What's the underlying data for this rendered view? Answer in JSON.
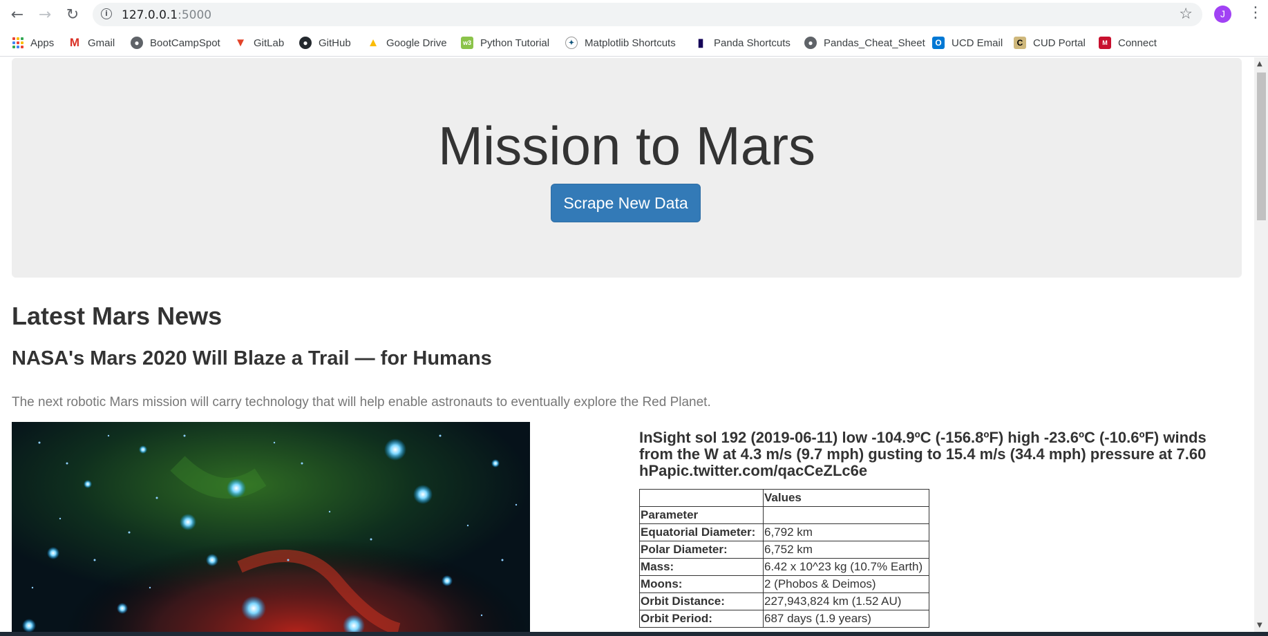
{
  "browser": {
    "url_host": "127.0.0.1",
    "url_port": ":5000",
    "profile_initial": "J",
    "bookmarks": [
      {
        "label": "Apps",
        "icon": "apps-grid-icon"
      },
      {
        "label": "Gmail",
        "icon": "gmail-icon"
      },
      {
        "label": "BootCampSpot",
        "icon": "globe-icon"
      },
      {
        "label": "GitLab",
        "icon": "gitlab-icon"
      },
      {
        "label": "GitHub",
        "icon": "github-icon"
      },
      {
        "label": "Google Drive",
        "icon": "google-drive-icon"
      },
      {
        "label": "Python Tutorial",
        "icon": "python-tutorial-icon"
      },
      {
        "label": "Matplotlib Shortcuts",
        "icon": "matplotlib-icon"
      },
      {
        "label": "Panda Shortcuts",
        "icon": "panda-icon"
      },
      {
        "label": "Pandas_Cheat_Sheet",
        "icon": "globe-icon"
      },
      {
        "label": "UCD Email",
        "icon": "outlook-icon"
      },
      {
        "label": "CUD Portal",
        "icon": "cu-icon"
      },
      {
        "label": "Connect",
        "icon": "connect-icon"
      }
    ]
  },
  "jumbotron": {
    "title": "Mission to Mars",
    "button_label": "Scrape New Data"
  },
  "news": {
    "section_title": "Latest Mars News",
    "headline": "NASA's Mars 2020 Will Blaze a Trail — for Humans",
    "teaser": "The next robotic Mars mission will carry technology that will help enable astronauts to eventually explore the Red Planet."
  },
  "weather": {
    "text": "InSight sol 192 (2019-06-11) low -104.9ºC (-156.8ºF) high -23.6ºC (-10.6ºF) winds from the W at 4.3 m/s (9.7 mph) gusting to 15.4 m/s (34.4 mph) pressure at 7.60 hPapic.twitter.com/qacCeZLc6e"
  },
  "facts": {
    "header_values": "Values",
    "header_parameter": "Parameter",
    "rows": [
      {
        "label": "Equatorial Diameter:",
        "value": "6,792 km"
      },
      {
        "label": "Polar Diameter:",
        "value": "6,752 km"
      },
      {
        "label": "Mass:",
        "value": "6.42 x 10^23 kg (10.7% Earth)"
      },
      {
        "label": "Moons:",
        "value": "2 (Phobos & Deimos)"
      },
      {
        "label": "Orbit Distance:",
        "value": "227,943,824 km (1.52 AU)"
      },
      {
        "label": "Orbit Period:",
        "value": "687 days (1.9 years)"
      }
    ]
  },
  "colors": {
    "jumbotron_bg": "#eeeeee",
    "button_primary": "#337ab7",
    "avatar": "#a142f4"
  }
}
